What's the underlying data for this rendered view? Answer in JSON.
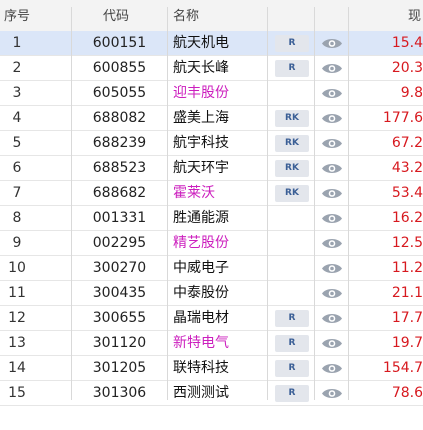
{
  "header": {
    "idx": "序号",
    "code": "代码",
    "name": "名称",
    "price": "现"
  },
  "rows": [
    {
      "idx": "1",
      "code": "600151",
      "name": "航天机电",
      "badge": "R",
      "price": "15.4",
      "selected": true,
      "mag": false
    },
    {
      "idx": "2",
      "code": "600855",
      "name": "航天长峰",
      "badge": "R",
      "price": "20.3",
      "selected": false,
      "mag": false
    },
    {
      "idx": "3",
      "code": "605055",
      "name": "迎丰股份",
      "badge": "",
      "price": "9.8",
      "selected": false,
      "mag": true
    },
    {
      "idx": "4",
      "code": "688082",
      "name": "盛美上海",
      "badge": "RK",
      "price": "177.6",
      "selected": false,
      "mag": false
    },
    {
      "idx": "5",
      "code": "688239",
      "name": "航宇科技",
      "badge": "RK",
      "price": "67.2",
      "selected": false,
      "mag": false
    },
    {
      "idx": "6",
      "code": "688523",
      "name": "航天环宇",
      "badge": "RK",
      "price": "43.2",
      "selected": false,
      "mag": false
    },
    {
      "idx": "7",
      "code": "688682",
      "name": "霍莱沃",
      "badge": "RK",
      "price": "53.4",
      "selected": false,
      "mag": true
    },
    {
      "idx": "8",
      "code": "001331",
      "name": "胜通能源",
      "badge": "",
      "price": "16.2",
      "selected": false,
      "mag": false
    },
    {
      "idx": "9",
      "code": "002295",
      "name": "精艺股份",
      "badge": "",
      "price": "12.5",
      "selected": false,
      "mag": true
    },
    {
      "idx": "10",
      "code": "300270",
      "name": "中威电子",
      "badge": "",
      "price": "11.2",
      "selected": false,
      "mag": false
    },
    {
      "idx": "11",
      "code": "300435",
      "name": "中泰股份",
      "badge": "",
      "price": "21.1",
      "selected": false,
      "mag": false
    },
    {
      "idx": "12",
      "code": "300655",
      "name": "晶瑞电材",
      "badge": "R",
      "price": "17.7",
      "selected": false,
      "mag": false
    },
    {
      "idx": "13",
      "code": "301120",
      "name": "新特电气",
      "badge": "R",
      "price": "19.7",
      "selected": false,
      "mag": true
    },
    {
      "idx": "14",
      "code": "301205",
      "name": "联特科技",
      "badge": "R",
      "price": "154.7",
      "selected": false,
      "mag": false
    },
    {
      "idx": "15",
      "code": "301306",
      "name": "西测测试",
      "badge": "R",
      "price": "78.6",
      "selected": false,
      "mag": false
    }
  ],
  "colors": {
    "price": "#d7191f",
    "name_highlight": "#cc1fbe",
    "selected_row": "#dbe6f8",
    "badge_text": "#3b5f96"
  },
  "icons": {
    "watch": "eye-icon"
  }
}
